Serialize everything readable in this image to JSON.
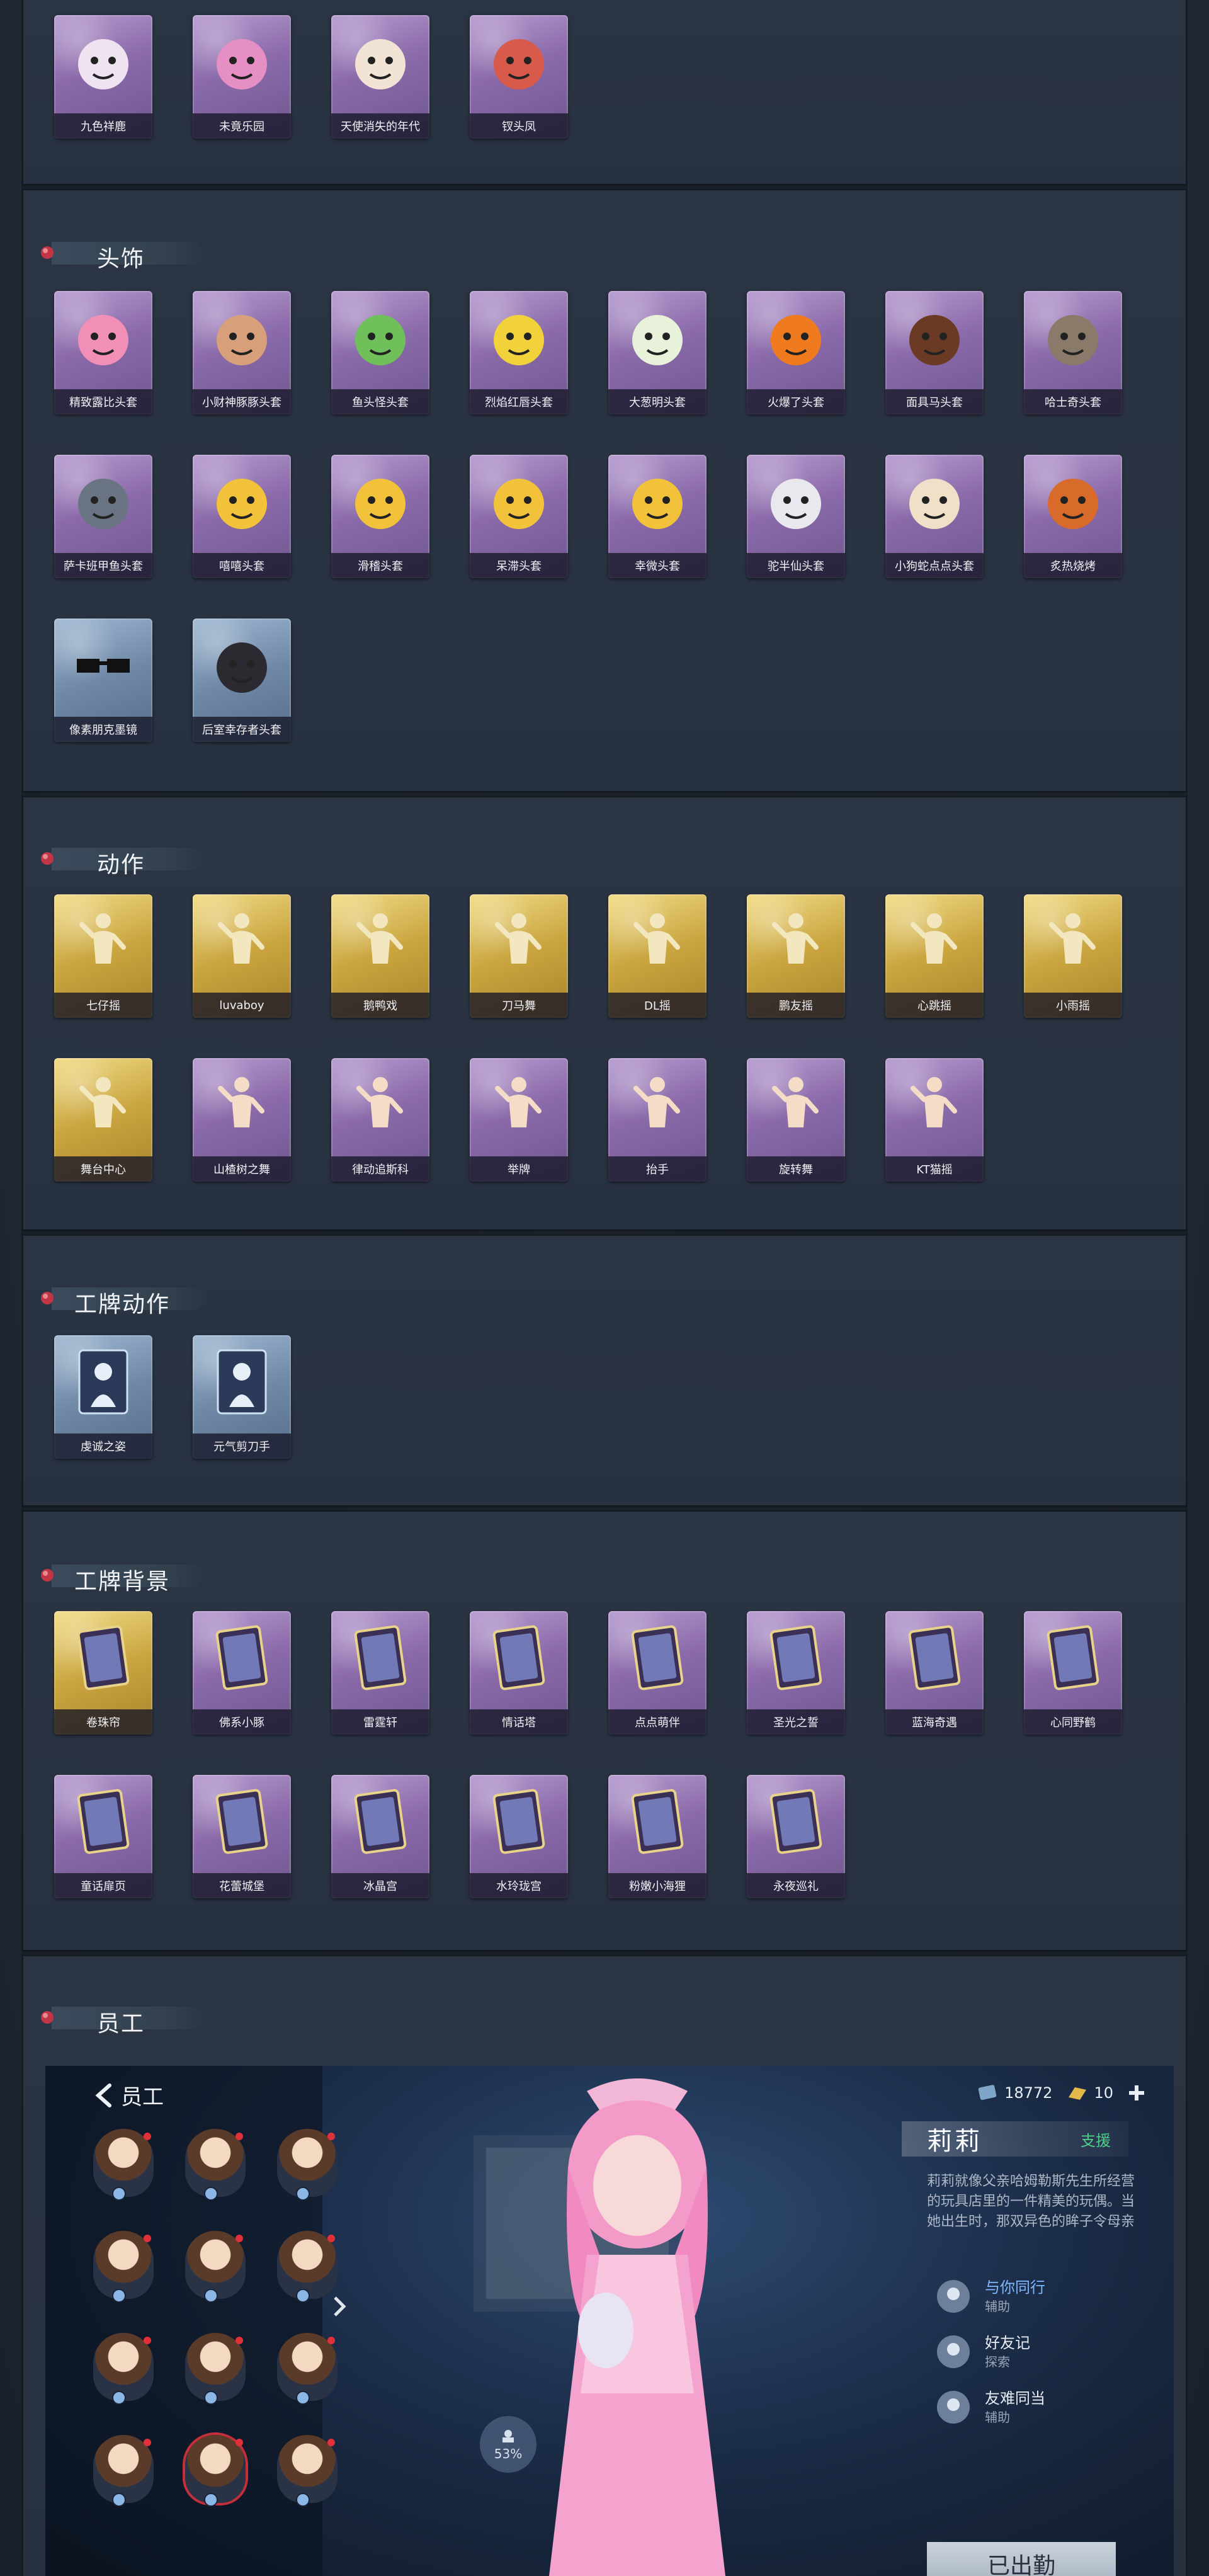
{
  "sections": {
    "top": {
      "items": [
        {
          "name": "九色祥鹿",
          "icon": "deer-figure-icon",
          "tone": "purple"
        },
        {
          "name": "未竟乐园",
          "icon": "jester-girl-icon",
          "tone": "purple"
        },
        {
          "name": "天使消失的年代",
          "icon": "angel-portrait-icon",
          "tone": "purple"
        },
        {
          "name": "钗头凤",
          "icon": "phoenix-lady-icon",
          "tone": "purple"
        }
      ]
    },
    "headwear": {
      "title": "头饰",
      "items": [
        {
          "name": "精致露比头套",
          "icon": "pink-bear-mask-icon",
          "tone": "purple"
        },
        {
          "name": "小财神豚豚头套",
          "icon": "piggy-mask-icon",
          "tone": "purple"
        },
        {
          "name": "鱼头怪头套",
          "icon": "fish-head-mask-icon",
          "tone": "purple"
        },
        {
          "name": "烈焰红唇头套",
          "icon": "yellow-mouse-mask-icon",
          "tone": "purple"
        },
        {
          "name": "大葱明头套",
          "icon": "scallion-mask-icon",
          "tone": "purple"
        },
        {
          "name": "火爆了头套",
          "icon": "fireball-mask-icon",
          "tone": "purple"
        },
        {
          "name": "面具马头套",
          "icon": "horse-mask-icon",
          "tone": "purple"
        },
        {
          "name": "哈士奇头套",
          "icon": "husky-mask-icon",
          "tone": "purple"
        },
        {
          "name": "萨卡班甲鱼头套",
          "icon": "ancient-fish-mask-icon",
          "tone": "purple"
        },
        {
          "name": "嘻嘻头套",
          "icon": "grin-emoji-mask-icon",
          "tone": "purple"
        },
        {
          "name": "滑稽头套",
          "icon": "smirk-emoji-mask-icon",
          "tone": "purple"
        },
        {
          "name": "呆滞头套",
          "icon": "dazed-emoji-mask-icon",
          "tone": "purple"
        },
        {
          "name": "幸微头套",
          "icon": "smile-emoji-mask-icon",
          "tone": "purple"
        },
        {
          "name": "驼半仙头套",
          "icon": "raccoon-mask-icon",
          "tone": "purple"
        },
        {
          "name": "小狗蛇点点头套",
          "icon": "spotted-snake-mask-icon",
          "tone": "purple"
        },
        {
          "name": "炙热烧烤",
          "icon": "bbq-mask-icon",
          "tone": "purple"
        },
        {
          "name": "像素朋克墨镜",
          "icon": "pixel-sunglasses-icon",
          "tone": "blue"
        },
        {
          "name": "后室幸存者头套",
          "icon": "gas-mask-icon",
          "tone": "blue"
        }
      ]
    },
    "actions": {
      "title": "动作",
      "items": [
        {
          "name": "七仔摇",
          "icon": "dance-pose-icon",
          "tone": "gold"
        },
        {
          "name": "luvaboy",
          "icon": "dance-pose-icon",
          "tone": "gold"
        },
        {
          "name": "鹅鸭戏",
          "icon": "dance-pose-icon",
          "tone": "gold"
        },
        {
          "name": "刀马舞",
          "icon": "dance-pose-icon",
          "tone": "gold"
        },
        {
          "name": "DL摇",
          "icon": "dance-pose-icon",
          "tone": "gold"
        },
        {
          "name": "鹏友摇",
          "icon": "dance-pose-icon",
          "tone": "gold"
        },
        {
          "name": "心跳摇",
          "icon": "dance-pose-icon",
          "tone": "gold"
        },
        {
          "name": "小雨摇",
          "icon": "dance-pose-icon",
          "tone": "gold"
        },
        {
          "name": "舞台中心",
          "icon": "dance-pose-icon",
          "tone": "gold"
        },
        {
          "name": "山楂树之舞",
          "icon": "dance-pose-icon",
          "tone": "purple"
        },
        {
          "name": "律动追斯科",
          "icon": "dance-pose-icon",
          "tone": "purple"
        },
        {
          "name": "举牌",
          "icon": "ghost-sign-icon",
          "tone": "purple"
        },
        {
          "name": "抬手",
          "icon": "raise-hand-icon",
          "tone": "purple"
        },
        {
          "name": "旋转舞",
          "icon": "spin-dance-icon",
          "tone": "purple"
        },
        {
          "name": "KT猫摇",
          "icon": "dance-pose-icon",
          "tone": "purple"
        }
      ]
    },
    "badge_actions": {
      "title": "工牌动作",
      "items": [
        {
          "name": "虔诚之姿",
          "icon": "praying-silhouette-icon",
          "tone": "blue"
        },
        {
          "name": "元气剪刀手",
          "icon": "peace-sign-silhouette-icon",
          "tone": "blue"
        }
      ]
    },
    "badge_backgrounds": {
      "title": "工牌背景",
      "items": [
        {
          "name": "卷珠帘",
          "icon": "card-curtain-icon",
          "tone": "gold"
        },
        {
          "name": "佛系小豚",
          "icon": "card-piglet-icon",
          "tone": "purple"
        },
        {
          "name": "雷霆轩",
          "icon": "card-thunder-icon",
          "tone": "purple"
        },
        {
          "name": "情话塔",
          "icon": "card-tower-icon",
          "tone": "purple"
        },
        {
          "name": "点点萌伴",
          "icon": "card-sunny-icon",
          "tone": "purple"
        },
        {
          "name": "圣光之誓",
          "icon": "card-holy-icon",
          "tone": "purple"
        },
        {
          "name": "蓝海奇遇",
          "icon": "card-ocean-icon",
          "tone": "purple"
        },
        {
          "name": "心同野鹤",
          "icon": "card-crane-icon",
          "tone": "purple"
        },
        {
          "name": "童话扉页",
          "icon": "card-fairytale-icon",
          "tone": "purple"
        },
        {
          "name": "花蕾城堡",
          "icon": "card-castle-icon",
          "tone": "purple"
        },
        {
          "name": "冰晶宫",
          "icon": "card-ice-palace-icon",
          "tone": "purple"
        },
        {
          "name": "水玲珑宫",
          "icon": "card-water-palace-icon",
          "tone": "purple"
        },
        {
          "name": "粉嫩小海狸",
          "icon": "card-beaver-icon",
          "tone": "purple"
        },
        {
          "name": "永夜巡礼",
          "icon": "card-night-icon",
          "tone": "purple"
        }
      ]
    },
    "staff": {
      "title": "员工"
    }
  },
  "employee_screen": {
    "back_label": "员工",
    "currency_a": "18772",
    "currency_b": "10",
    "character_name": "莉莉",
    "character_role": "支援",
    "description": "莉莉就像父亲哈姆勒斯先生所经营的玩具店里的一件精美的玩偶。当她出生时，那双异色的眸子令母亲",
    "skills": [
      {
        "name": "与你同行",
        "sub": "辅助",
        "highlight": true,
        "icon": "bunny-skill-icon"
      },
      {
        "name": "好友记",
        "sub": "探索",
        "highlight": false,
        "icon": "hand-skill-icon"
      },
      {
        "name": "友难同当",
        "sub": "辅助",
        "highlight": false,
        "icon": "shield-skill-icon"
      }
    ],
    "percent": "53%",
    "deploy_label": "已出勤"
  },
  "colors": {
    "accent_pin": "#c23545",
    "skill_highlight": "#7fb7ff",
    "role_green": "#4fd08a"
  }
}
